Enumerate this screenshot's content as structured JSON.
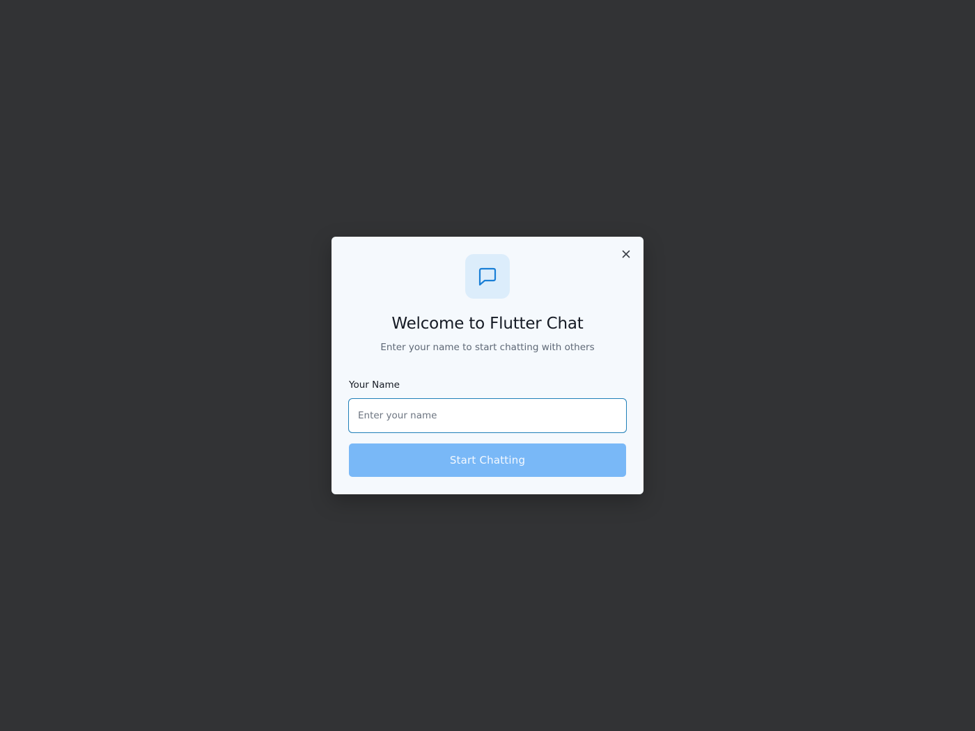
{
  "dialog": {
    "title": "Welcome to Flutter Chat",
    "subtitle": "Enter your name to start chatting with others",
    "field_label": "Your Name",
    "name_input": {
      "value": "",
      "placeholder": "Enter your name"
    },
    "submit_label": "Start Chatting",
    "icons": {
      "header": "chat-bubble-icon",
      "close": "close-icon"
    }
  },
  "colors": {
    "accent": "#1a7fd6",
    "button_bg": "#79b8f7",
    "icon_tile_bg": "#dcedfb",
    "modal_bg": "#f5f9fd",
    "backdrop": "#323335"
  }
}
